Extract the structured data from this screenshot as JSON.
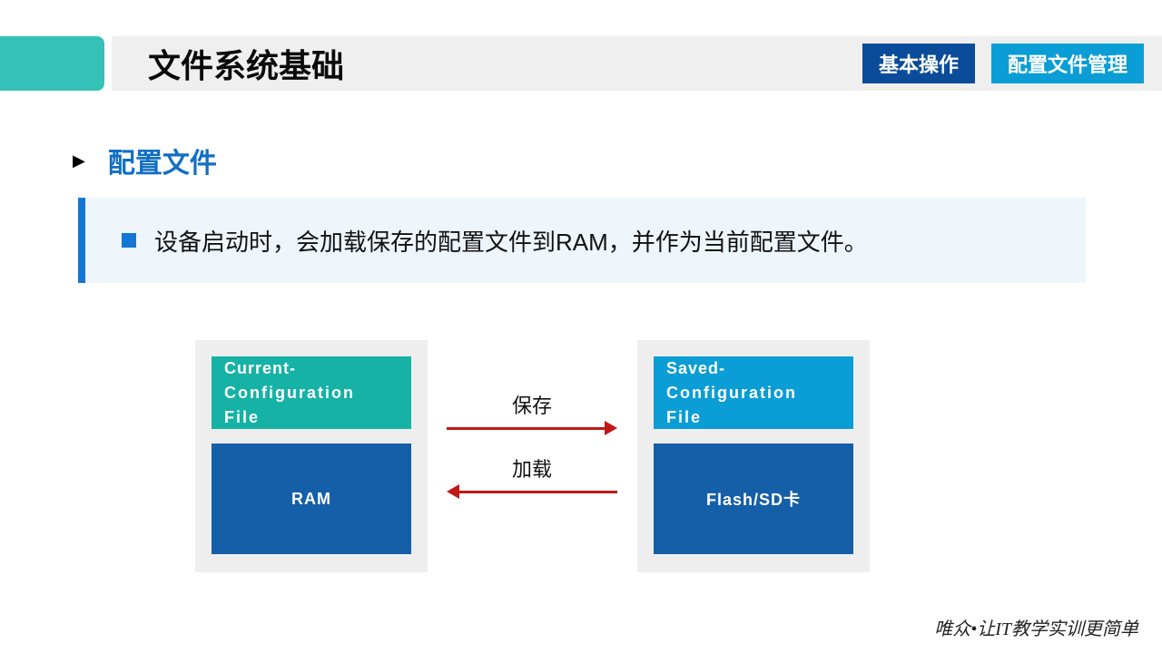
{
  "header": {
    "title": "文件系统基础",
    "tab1": "基本操作",
    "tab2": "配置文件管理"
  },
  "section": {
    "title": "配置文件"
  },
  "info": {
    "text": "设备启动时，会加载保存的配置文件到RAM，并作为当前配置文件。"
  },
  "diagram": {
    "left_box_line1": "Current-",
    "left_box_line2": "Configuration File",
    "left_store": "RAM",
    "right_box_line1": "Saved-",
    "right_box_line2": "Configuration File",
    "right_store": "Flash/SD卡",
    "arrow_top_label": "保存",
    "arrow_bottom_label": "加载"
  },
  "footer": {
    "tagline": "唯众•让IT教学实训更简单"
  }
}
